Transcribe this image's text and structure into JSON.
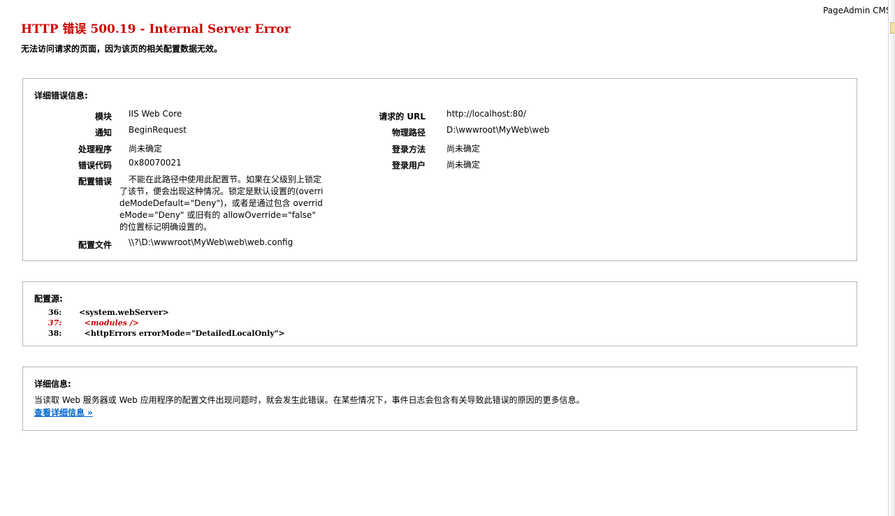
{
  "brand": "PageAdmin CMS",
  "header": {
    "title": "HTTP 错误 500.19 - Internal Server Error",
    "subtitle": "无法访问请求的页面，因为该页的相关配置数据无效。"
  },
  "details": {
    "heading": "详细错误信息:",
    "left": [
      {
        "key": "模块",
        "value": "IIS Web Core"
      },
      {
        "key": "通知",
        "value": "BeginRequest"
      },
      {
        "key": "处理程序",
        "value": "尚未确定"
      },
      {
        "key": "错误代码",
        "value": "0x80070021"
      },
      {
        "key": "配置错误",
        "value": "不能在此路径中使用此配置节。如果在父级别上锁定了该节，便会出现这种情况。锁定是默认设置的(overrideModeDefault=\"Deny\")，或者是通过包含 overrideMode=\"Deny\" 或旧有的 allowOverride=\"false\" 的位置标记明确设置的。"
      },
      {
        "key": "配置文件",
        "value": "\\\\?\\D:\\wwwroot\\MyWeb\\web\\web.config"
      }
    ],
    "right": [
      {
        "key": "请求的 URL",
        "value": "http://localhost:80/"
      },
      {
        "key": "物理路径",
        "value": "D:\\wwwroot\\MyWeb\\web"
      },
      {
        "key": "登录方法",
        "value": "尚未确定"
      },
      {
        "key": "登录用户",
        "value": "尚未确定"
      }
    ]
  },
  "config_source": {
    "heading": "配置源:",
    "lines": [
      {
        "num": "36:",
        "code": "<system.webServer>"
      },
      {
        "num": "37:",
        "code": "  <modules />"
      },
      {
        "num": "38:",
        "code": "  <httpErrors errorMode=\"DetailedLocalOnly\">"
      }
    ]
  },
  "more_info": {
    "heading": "详细信息:",
    "text": "当读取 Web 服务器或 Web 应用程序的配置文件出现问题时，就会发生此错误。在某些情况下，事件日志会包含有关导致此错误的原因的更多信息。",
    "link": "查看详细信息 »"
  },
  "colors": {
    "error_red": "#cc0000",
    "link_blue": "#0066cc"
  }
}
